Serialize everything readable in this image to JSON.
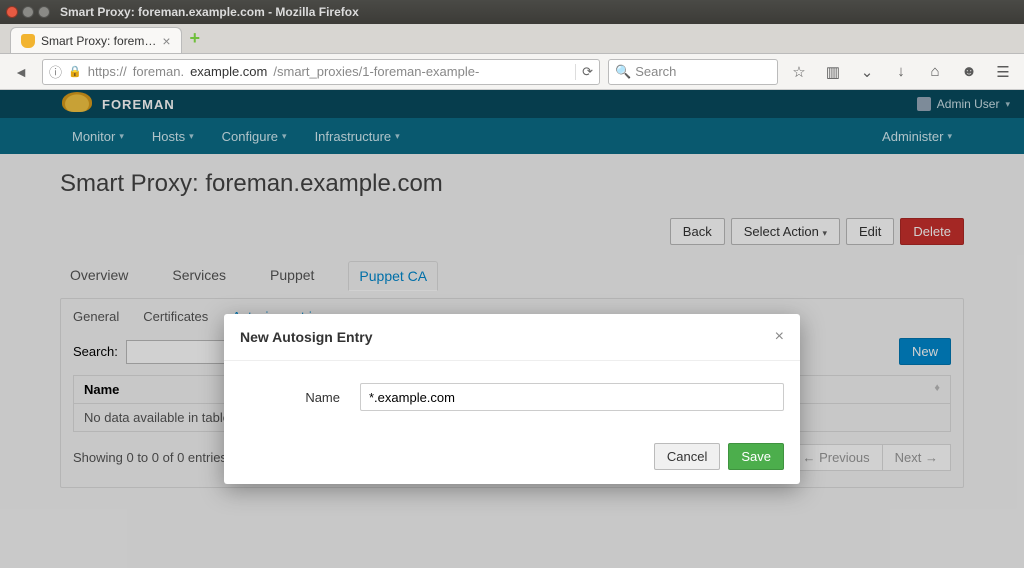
{
  "window": {
    "title": "Smart Proxy: foreman.example.com - Mozilla Firefox"
  },
  "browser_tab": {
    "label": "Smart Proxy: forem…"
  },
  "url": {
    "proto": "https://",
    "sub": "foreman.",
    "host": "example.com",
    "path": "/smart_proxies/1-foreman-example-"
  },
  "search": {
    "placeholder": "Search"
  },
  "brand": "FOREMAN",
  "user": {
    "name": "Admin User"
  },
  "nav": {
    "items": [
      "Monitor",
      "Hosts",
      "Configure",
      "Infrastructure"
    ],
    "right": "Administer"
  },
  "page_title": "Smart Proxy: foreman.example.com",
  "actions": {
    "back": "Back",
    "select": "Select Action",
    "edit": "Edit",
    "delete": "Delete"
  },
  "tabs": [
    "Overview",
    "Services",
    "Puppet",
    "Puppet CA"
  ],
  "subtabs": [
    "General",
    "Certificates",
    "Autosign entries"
  ],
  "searchrow": {
    "label": "Search:",
    "new": "New"
  },
  "table": {
    "header": "Name",
    "empty": "No data available in table"
  },
  "footer": {
    "info": "Showing 0 to 0 of 0 entries",
    "prev": "← Previous",
    "next": "Next →"
  },
  "modal": {
    "title": "New Autosign Entry",
    "field_label": "Name",
    "value": "*.example.com",
    "cancel": "Cancel",
    "save": "Save"
  }
}
